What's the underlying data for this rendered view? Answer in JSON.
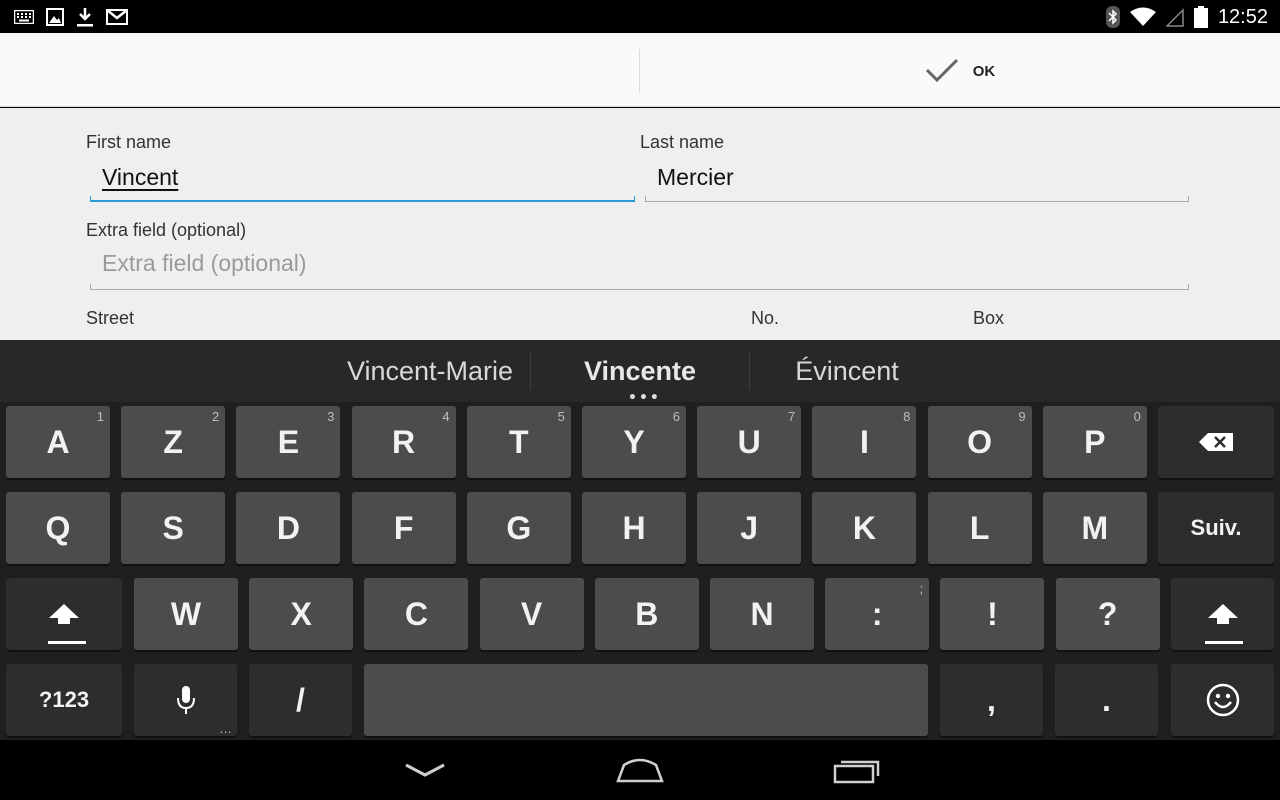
{
  "status_bar": {
    "time": "12:52",
    "left_icons": [
      "keyboard-icon",
      "image-icon",
      "download-icon",
      "gmail-icon"
    ],
    "right_icons": [
      "bluetooth-icon",
      "wifi-icon",
      "signal-icon",
      "battery-icon"
    ]
  },
  "action_bar": {
    "ok_label": "OK"
  },
  "form": {
    "first_name": {
      "label": "First name",
      "value": "Vincent"
    },
    "last_name": {
      "label": "Last name",
      "value": "Mercier"
    },
    "extra_field": {
      "label": "Extra field (optional)",
      "placeholder": "Extra field (optional)",
      "value": ""
    },
    "street": {
      "label": "Street"
    },
    "number": {
      "label": "No."
    },
    "box": {
      "label": "Box"
    }
  },
  "keyboard": {
    "suggestions": [
      "Vincent-Marie",
      "Vincente",
      "Évincent"
    ],
    "row1": [
      {
        "label": "A",
        "hint": "1"
      },
      {
        "label": "Z",
        "hint": "2"
      },
      {
        "label": "E",
        "hint": "3"
      },
      {
        "label": "R",
        "hint": "4"
      },
      {
        "label": "T",
        "hint": "5"
      },
      {
        "label": "Y",
        "hint": "6"
      },
      {
        "label": "U",
        "hint": "7"
      },
      {
        "label": "I",
        "hint": "8"
      },
      {
        "label": "O",
        "hint": "9"
      },
      {
        "label": "P",
        "hint": "0"
      }
    ],
    "row2": [
      {
        "label": "Q"
      },
      {
        "label": "S"
      },
      {
        "label": "D"
      },
      {
        "label": "F"
      },
      {
        "label": "G"
      },
      {
        "label": "H"
      },
      {
        "label": "J"
      },
      {
        "label": "K"
      },
      {
        "label": "L"
      },
      {
        "label": "M"
      }
    ],
    "row3": [
      {
        "label": "W"
      },
      {
        "label": "X"
      },
      {
        "label": "C"
      },
      {
        "label": "V"
      },
      {
        "label": "B"
      },
      {
        "label": "N"
      },
      {
        "label": ":",
        "hint": ";"
      },
      {
        "label": "!"
      },
      {
        "label": "?"
      }
    ],
    "next_label": "Suiv.",
    "symbols_label": "?123",
    "slash_label": "/",
    "comma_label": ",",
    "period_label": ".",
    "mic_hint": "…",
    "colors": {
      "key": "#4a4c4e",
      "key_dark": "#2b2d2f",
      "accent": "#2b9bd6"
    }
  },
  "nav_bar": {
    "icons": [
      "back-icon",
      "home-icon",
      "recents-icon"
    ]
  }
}
